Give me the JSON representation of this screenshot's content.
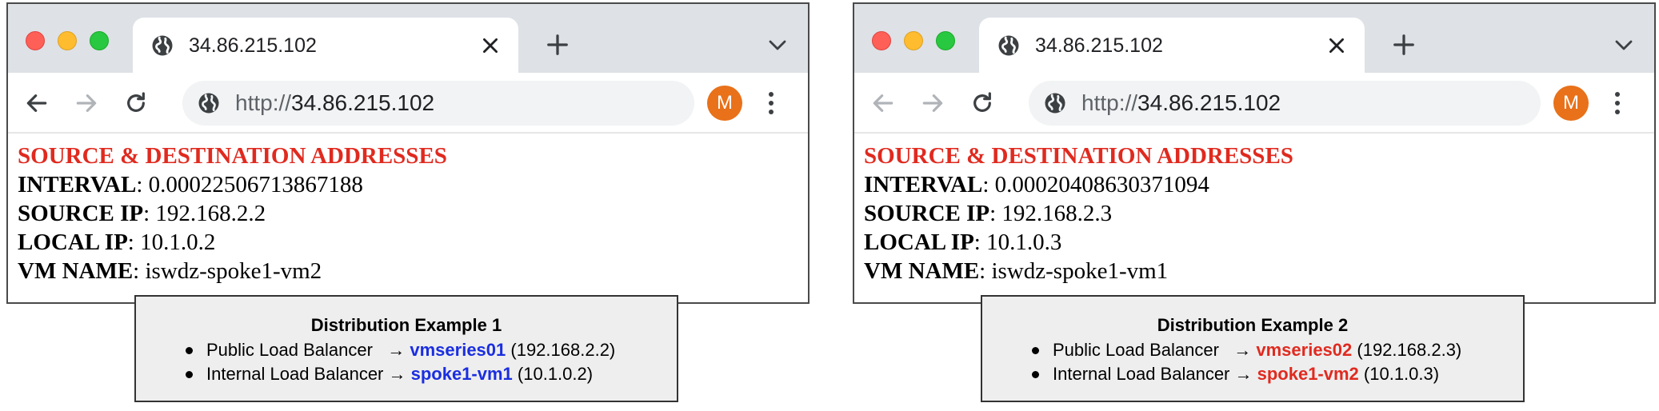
{
  "colors": {
    "heading_red": "#e02a1f",
    "highlight_blue": "#1a2ee0",
    "highlight_red": "#e02a1f",
    "avatar_orange": "#e8711a"
  },
  "windows": [
    {
      "tab_title": "34.86.215.102",
      "url_scheme": "http://",
      "url_host": "34.86.215.102",
      "avatar_initial": "M",
      "back_enabled": true,
      "page": {
        "heading": "SOURCE & DESTINATION ADDRESSES",
        "rows": [
          {
            "label": "INTERVAL",
            "value": ": 0.00022506713867188"
          },
          {
            "label": "SOURCE IP",
            "value": ": 192.168.2.2"
          },
          {
            "label": "LOCAL IP",
            "value": ": 10.1.0.2"
          },
          {
            "label": "VM NAME",
            "value": ": iswdz-spoke1-vm2"
          }
        ]
      },
      "callout": {
        "title": "Distribution Example 1",
        "items": [
          {
            "prefix": "Public Load Balancer   → ",
            "target": "vmseries01",
            "suffix": " (192.168.2.2)"
          },
          {
            "prefix": "Internal Load Balancer → ",
            "target": "spoke1-vm1",
            "suffix": " (10.1.0.2)"
          }
        ],
        "highlight": "#1a2ee0"
      }
    },
    {
      "tab_title": "34.86.215.102",
      "url_scheme": "http://",
      "url_host": "34.86.215.102",
      "avatar_initial": "M",
      "back_enabled": false,
      "page": {
        "heading": "SOURCE & DESTINATION ADDRESSES",
        "rows": [
          {
            "label": "INTERVAL",
            "value": ": 0.00020408630371094"
          },
          {
            "label": "SOURCE IP",
            "value": ": 192.168.2.3"
          },
          {
            "label": "LOCAL IP",
            "value": ": 10.1.0.3"
          },
          {
            "label": "VM NAME",
            "value": ": iswdz-spoke1-vm1"
          }
        ]
      },
      "callout": {
        "title": "Distribution Example 2",
        "items": [
          {
            "prefix": "Public Load Balancer   → ",
            "target": "vmseries02",
            "suffix": " (192.168.2.3)"
          },
          {
            "prefix": "Internal Load Balancer → ",
            "target": "spoke1-vm2",
            "suffix": " (10.1.0.3)"
          }
        ],
        "highlight": "#e02a1f"
      }
    }
  ],
  "icons": {
    "tab_favicon": "globe-icon",
    "tab_close": "close-icon",
    "new_tab": "plus-icon",
    "tab_menu": "chevron-down-icon",
    "back": "arrow-left-icon",
    "forward": "arrow-right-icon",
    "reload": "reload-icon",
    "site_info": "globe-icon",
    "menu": "kebab-menu-icon"
  }
}
